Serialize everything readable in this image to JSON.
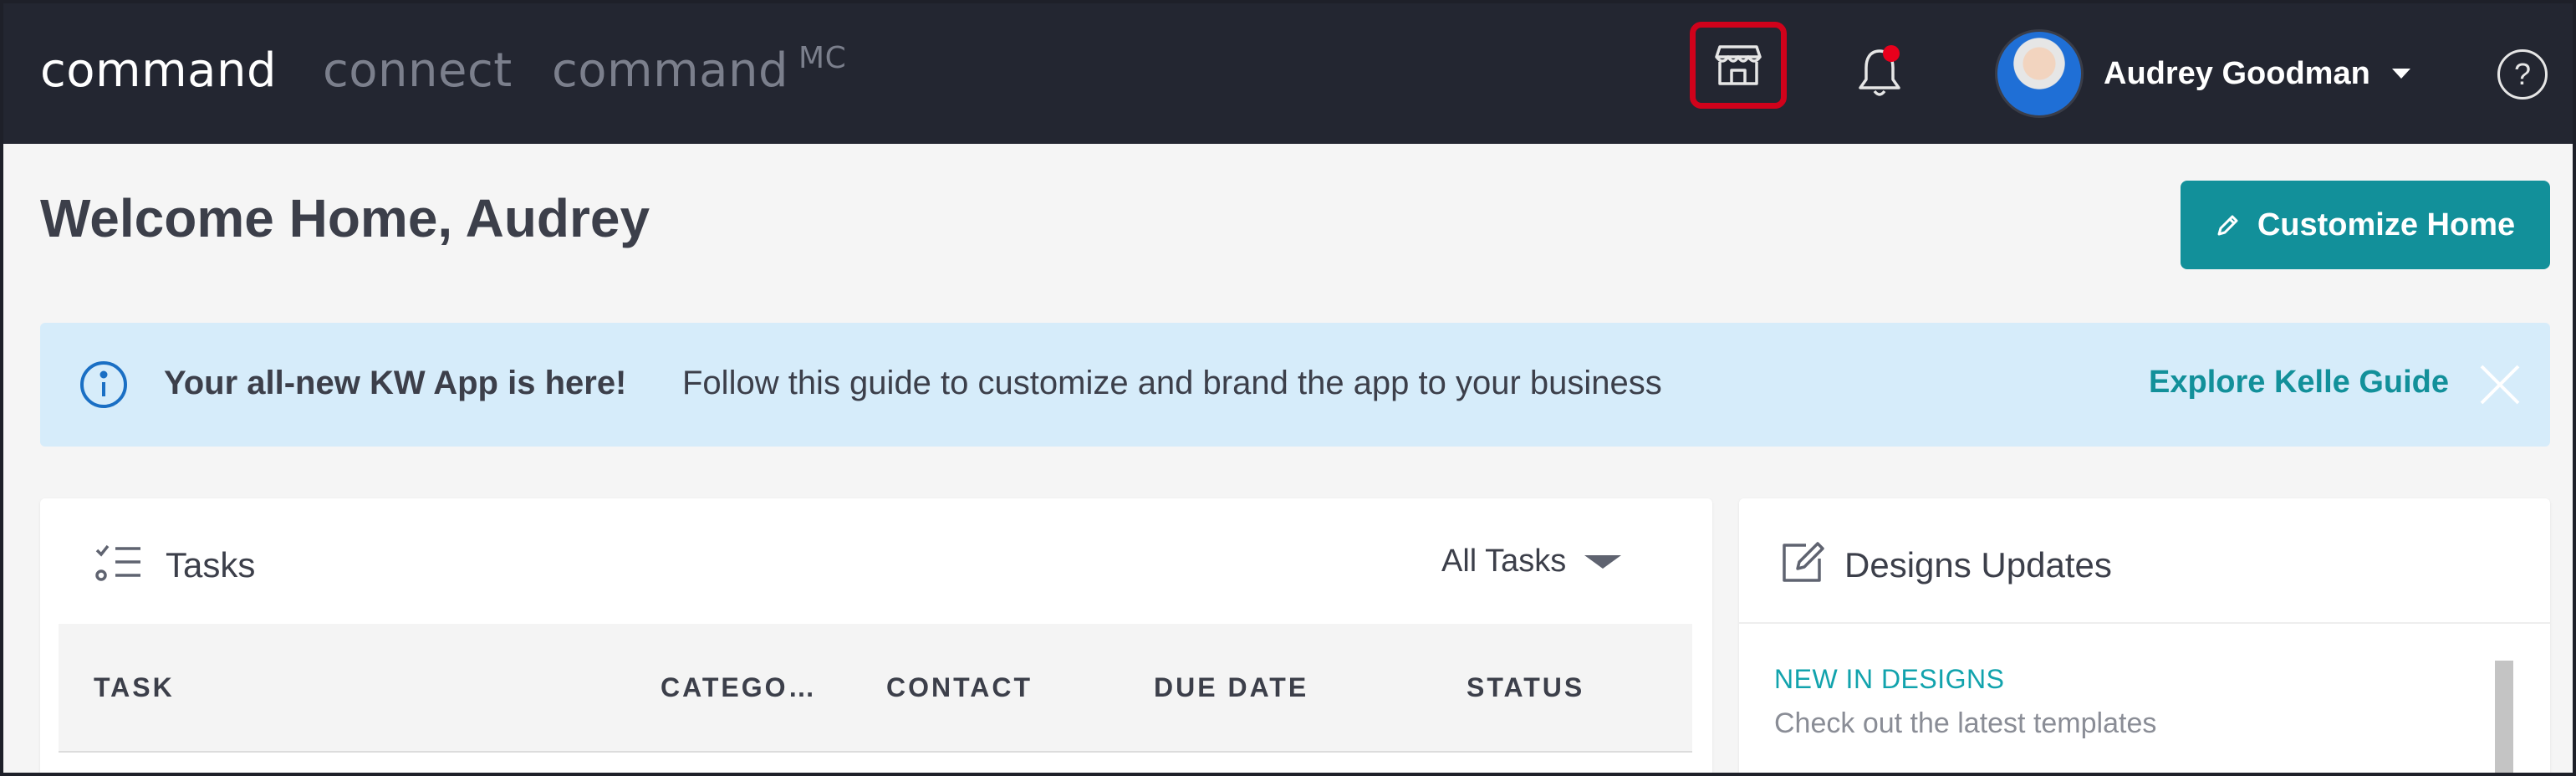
{
  "topbar": {
    "brand_command": "command",
    "brand_connect": "connect",
    "brand_cmc": "command",
    "brand_cmc_sup": "MC",
    "store_icon": "storefront-icon",
    "bell_icon": "bell-icon",
    "user_name": "Audrey Goodman",
    "help_label": "?"
  },
  "page": {
    "title": "Welcome Home, Audrey",
    "customize_label": "Customize Home"
  },
  "banner": {
    "strong": "Your all-new KW App is here!",
    "text": "Follow this guide to customize and brand the app to your business",
    "link": "Explore Kelle Guide"
  },
  "tasks": {
    "title": "Tasks",
    "filter": "All Tasks",
    "columns": [
      "TASK",
      "CATEGO…",
      "CONTACT",
      "DUE DATE",
      "STATUS"
    ]
  },
  "designs": {
    "title": "Designs Updates",
    "tag": "NEW IN DESIGNS",
    "subtitle": "Check out the latest templates"
  },
  "colors": {
    "topbar_bg": "#232631",
    "accent_teal": "#12909a",
    "highlight_red": "#d0021b",
    "banner_bg": "#d6ecfa"
  }
}
